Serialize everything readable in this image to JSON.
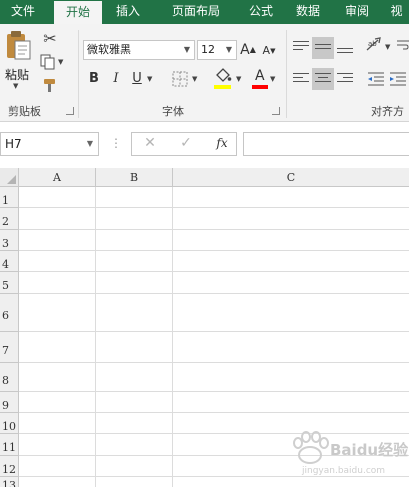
{
  "tabs": [
    "文件",
    "开始",
    "插入",
    "页面布局",
    "公式",
    "数据",
    "审阅",
    "视"
  ],
  "ribbon": {
    "clipboard": {
      "paste_label": "粘贴",
      "group_label": "剪贴板"
    },
    "font": {
      "font_name": "微软雅黑",
      "font_size": "12",
      "bold": "B",
      "italic": "I",
      "underline": "U",
      "grow": "A",
      "shrink": "A",
      "font_color_letter": "A",
      "group_label": "字体",
      "fill_color": "#ffff00",
      "font_color": "#ff0000"
    },
    "alignment": {
      "group_label": "对齐方"
    }
  },
  "formula_bar": {
    "cell_ref": "H7",
    "cancel": "✕",
    "enter": "✓",
    "fx": "fx",
    "formula": ""
  },
  "sheet": {
    "columns": [
      "A",
      "B",
      "C"
    ],
    "rows": [
      "1",
      "2",
      "3",
      "4",
      "5",
      "6",
      "7",
      "8",
      "9",
      "10",
      "11",
      "12",
      "13"
    ]
  },
  "watermark": {
    "text": "Baidu经验",
    "sub": "jingyan.baidu.com"
  },
  "colors": {
    "accent": "#217346",
    "ribbon_bg": "#f3f3f3",
    "selected": "#c8c8c8"
  }
}
